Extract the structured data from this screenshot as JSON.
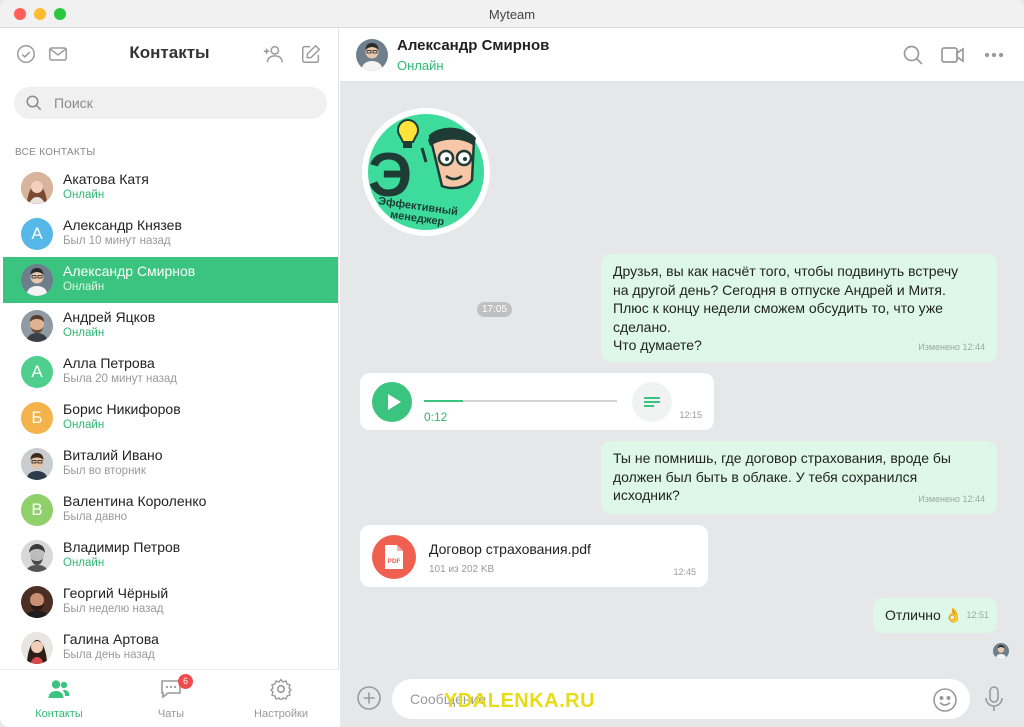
{
  "window": {
    "title": "Myteam"
  },
  "sidebar": {
    "title": "Контакты",
    "search_placeholder": "Поиск",
    "section_label": "ВСЕ КОНТАКТЫ",
    "contacts": [
      {
        "name": "Акатова Катя",
        "status": "Онлайн",
        "online": true,
        "avatar": "photo"
      },
      {
        "name": "Александр Князев",
        "status": "Был 10 минут назад",
        "online": false,
        "avatar": "letter",
        "letter": "А",
        "color": "#55b8e8"
      },
      {
        "name": "Александр Смирнов",
        "status": "Онлайн",
        "online": true,
        "avatar": "photo",
        "active": true
      },
      {
        "name": "Андрей Яцков",
        "status": "Онлайн",
        "online": true,
        "avatar": "photo"
      },
      {
        "name": "Алла Петрова",
        "status": "Была 20 минут назад",
        "online": false,
        "avatar": "letter",
        "letter": "А",
        "color": "#4fcf8e"
      },
      {
        "name": "Борис Никифоров",
        "status": "Онлайн",
        "online": true,
        "avatar": "letter",
        "letter": "Б",
        "color": "#f3b24a"
      },
      {
        "name": "Виталий Ивано",
        "status": "Был во вторник",
        "online": false,
        "avatar": "photo"
      },
      {
        "name": "Валентина Короленко",
        "status": "Была давно",
        "online": false,
        "avatar": "letter",
        "letter": "В",
        "color": "#8fd06b"
      },
      {
        "name": "Владимир Петров",
        "status": "Онлайн",
        "online": true,
        "avatar": "photo"
      },
      {
        "name": "Георгий Чёрный",
        "status": "Был неделю назад",
        "online": false,
        "avatar": "photo"
      },
      {
        "name": "Галина Артова",
        "status": "Была день назад",
        "online": false,
        "avatar": "photo"
      }
    ],
    "tabs": [
      {
        "label": "Контакты",
        "active": true
      },
      {
        "label": "Чаты",
        "badge": "6"
      },
      {
        "label": "Настройки"
      }
    ]
  },
  "chat": {
    "name": "Александр Смирнов",
    "status": "Онлайн",
    "sticker": {
      "line1": "Эффективный",
      "line2": "менеджер",
      "letter": "Э",
      "time": "17:05"
    },
    "messages": [
      {
        "text1": "Друзья, вы как насчёт того, чтобы подвинуть встречу",
        "text2": "на другой день? Сегодня в отпуске Андрей и Митя.",
        "text3": "Плюс к концу недели сможем обсудить то, что уже",
        "text4": "сделано.",
        "text5": "Что думаете?",
        "meta": "Изменено 12:44"
      },
      {
        "duration": "0:12",
        "progress": 0.2,
        "time": "12:15"
      },
      {
        "text1": "Ты не помнишь, где договор страхования, вроде бы",
        "text2": "должен был быть в облаке. У тебя сохранился",
        "text3": "исходник?",
        "meta": "Изменено 12:44"
      },
      {
        "file_name": "Договор страхования.pdf",
        "file_size": "101 из 202 KB",
        "file_type": "PDF",
        "time": "12:45"
      },
      {
        "text": "Отлично",
        "emoji": "👌",
        "time": "12:51"
      }
    ],
    "composer_placeholder": "Сообщение"
  },
  "watermark": "YDALENKA.RU",
  "colors": {
    "accent": "#3bc47f",
    "out_bubble": "#ddf8e6",
    "chat_bg": "#e6e7e9",
    "badge": "#ef4b4b",
    "pdf": "#ef6050"
  }
}
